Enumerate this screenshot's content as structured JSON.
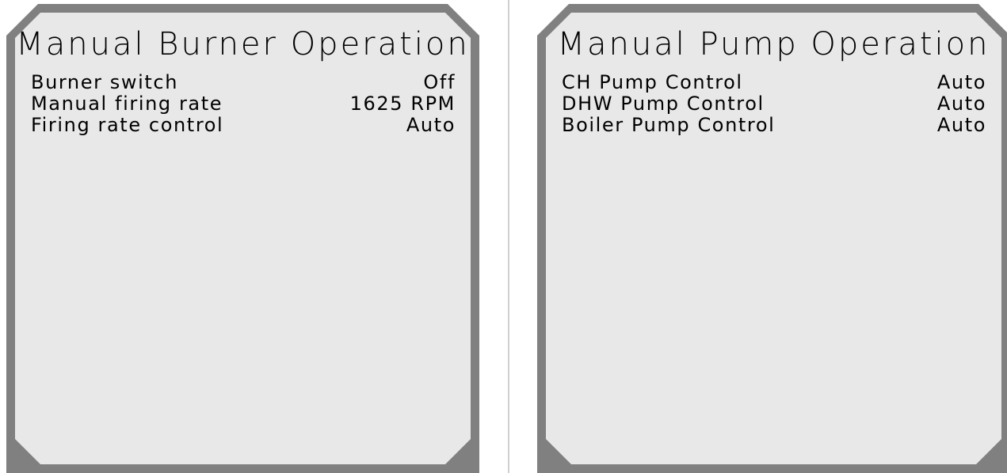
{
  "colors": {
    "frame": "#808080",
    "panel_fill": "#e8e8e8",
    "divider": "#d0d0d0",
    "text": "#000000"
  },
  "burner_panel": {
    "title": "Manual Burner Operation",
    "rows": [
      {
        "label": "Burner switch",
        "value": "Off"
      },
      {
        "label": "Manual firing rate",
        "value": "1625 RPM"
      },
      {
        "label": "Firing rate control",
        "value": "Auto"
      }
    ]
  },
  "pump_panel": {
    "title": "Manual Pump Operation",
    "rows": [
      {
        "label": "CH Pump Control",
        "value": "Auto"
      },
      {
        "label": "DHW Pump Control",
        "value": "Auto"
      },
      {
        "label": "Boiler Pump Control",
        "value": "Auto"
      }
    ]
  }
}
